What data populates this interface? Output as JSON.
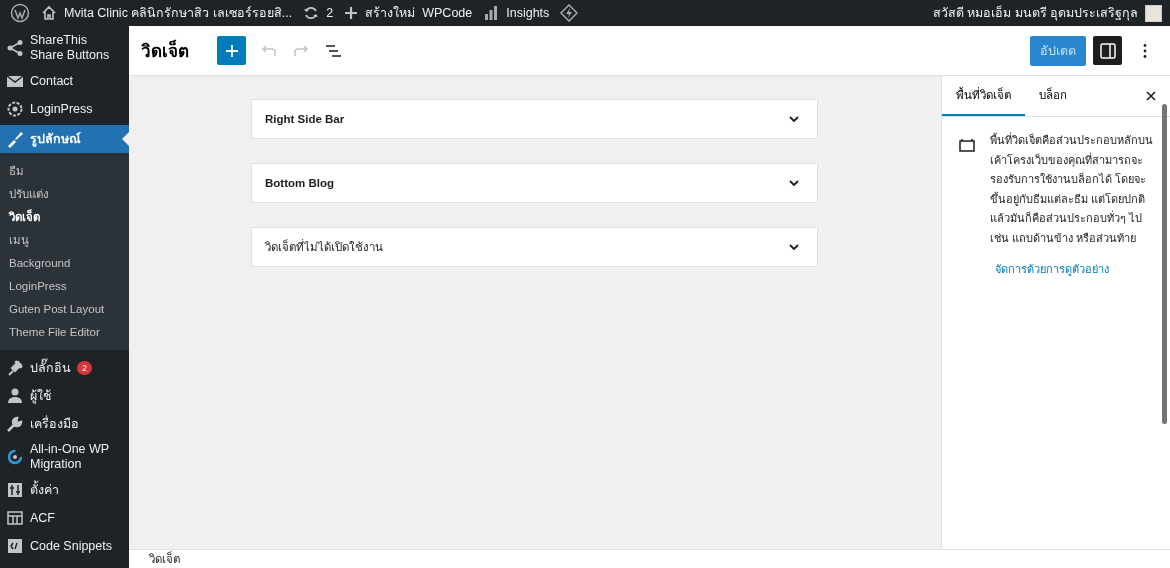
{
  "admin_bar": {
    "site_title": "Mvita Clinic คลินิกรักษาสิว เลเซอร์รอยสิ...",
    "updates_count": "2",
    "new_label": "สร้างใหม่",
    "items": [
      "WPCode",
      "Insights"
    ],
    "greeting": "สวัสดี หมอเอ็ม มนตรี อุดมประเสริฐกุล"
  },
  "sidebar": {
    "items": [
      {
        "label": "ShareThis Share Buttons",
        "selected": false
      },
      {
        "label": "Contact",
        "selected": false
      },
      {
        "label": "LoginPress",
        "selected": false
      },
      {
        "label": "รูปลักษณ์",
        "selected": true,
        "submenu": [
          {
            "label": "ธีม",
            "selected": false
          },
          {
            "label": "ปรับแต่ง",
            "selected": false
          },
          {
            "label": "วิดเจ็ต",
            "selected": true
          },
          {
            "label": "เมนู",
            "selected": false
          },
          {
            "label": "Background",
            "selected": false
          },
          {
            "label": "LoginPress",
            "selected": false
          },
          {
            "label": "Guten Post Layout",
            "selected": false
          },
          {
            "label": "Theme File Editor",
            "selected": false
          }
        ]
      },
      {
        "label": "ปลั๊กอิน",
        "selected": false,
        "badge": "2"
      },
      {
        "label": "ผู้ใช้",
        "selected": false
      },
      {
        "label": "เครื่องมือ",
        "selected": false
      },
      {
        "label": "All-in-One WP Migration",
        "selected": false
      },
      {
        "label": "ตั้งค่า",
        "selected": false
      },
      {
        "label": "ACF",
        "selected": false
      },
      {
        "label": "Code Snippets",
        "selected": false
      }
    ]
  },
  "editor": {
    "title": "วิดเจ็ต",
    "undo_disabled": true,
    "redo_disabled": true,
    "update_button": "อัปเดต",
    "settings_pressed": true
  },
  "widget_areas": [
    {
      "title": "Right Side Bar",
      "expanded": false
    },
    {
      "title": "Bottom Blog",
      "expanded": false
    },
    {
      "title": "วิดเจ็ตที่ไม่ได้เปิดใช้งาน",
      "expanded": false
    }
  ],
  "panel": {
    "tabs": [
      {
        "label": "พื้นที่วิดเจ็ต",
        "selected": true
      },
      {
        "label": "บล็อก",
        "selected": false
      }
    ],
    "description": "พื้นที่วิดเจ็ตคือส่วนประกอบหลักบนเค้าโครงเว็บของคุณที่สามารถจะรองรับการใช้งานบล็อกได้ โดยจะขึ้นอยู่กับธีมแต่ละธีม แต่โดยปกติแล้วมันก็คือส่วนประกอบทั่วๆ ไป เช่น แถบด้านข้าง หรือส่วนท้าย",
    "link": "จัดการด้วยการดูตัวอย่าง"
  },
  "footer": {
    "breadcrumb": "วิดเจ็ต"
  }
}
